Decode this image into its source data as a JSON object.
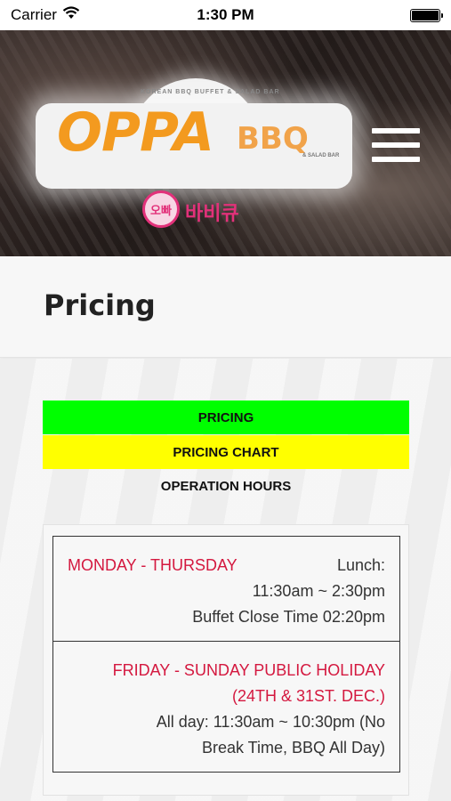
{
  "status_bar": {
    "carrier": "Carrier",
    "time": "1:30 PM",
    "icons": [
      "wifi-icon",
      "battery-icon"
    ]
  },
  "header": {
    "logo": {
      "primary": "OPPA",
      "secondary": "BBQ",
      "arc_text": "KOREAN BBQ BUFFET & SALAD BAR",
      "sub_text": "& SALAD BAR",
      "korean_circle": "오빠",
      "korean_text": "바비큐"
    },
    "menu_icon": "hamburger-menu-icon"
  },
  "page": {
    "title": "Pricing"
  },
  "tabs": [
    {
      "label": "PRICING",
      "color": "#00ff00"
    },
    {
      "label": "PRICING CHART",
      "color": "#ffff00"
    },
    {
      "label": "OPERATION HOURS",
      "color": "transparent"
    }
  ],
  "hours": {
    "rows": [
      {
        "day": "MONDAY - THURSDAY",
        "lines": [
          "Lunch:",
          "11:30am ~ 2:30pm",
          "Buffet Close Time 02:20pm"
        ]
      },
      {
        "day_lines": [
          "FRIDAY - SUNDAY PUBLIC HOLIDAY",
          "(24TH & 31ST. DEC.)"
        ],
        "lines": [
          "All day: 11:30am ~ 10:30pm (No",
          "Break Time, BBQ All Day)"
        ]
      }
    ]
  },
  "colors": {
    "day_accent": "#d4183f",
    "logo_orange": "#f39a1f",
    "logo_pink": "#e2317a"
  }
}
